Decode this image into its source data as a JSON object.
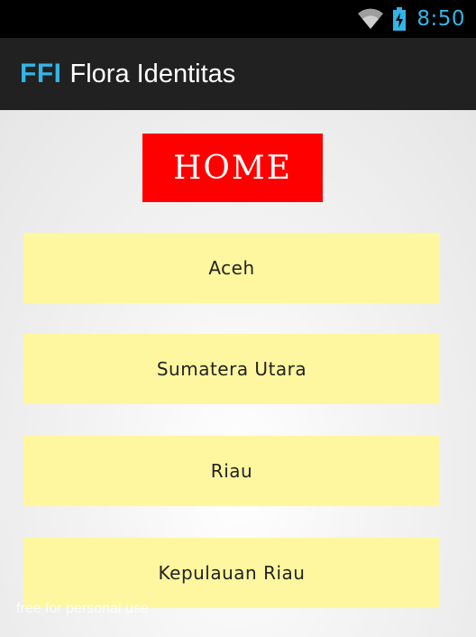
{
  "status_bar": {
    "time": "8:50",
    "wifi_icon": "wifi-icon",
    "battery_icon": "battery-charging-icon",
    "accent_color": "#33b5e5"
  },
  "action_bar": {
    "logo": "FFI",
    "title": "Flora Identitas",
    "background": "#212121"
  },
  "home_banner": {
    "label": "HOME",
    "color": "#fe0000"
  },
  "province_buttons": {
    "color": "#fff79f",
    "items": [
      {
        "label": "Aceh"
      },
      {
        "label": "Sumatera Utara"
      },
      {
        "label": "Riau"
      },
      {
        "label": "Kepulauan Riau"
      }
    ]
  },
  "watermark": "free for personal use"
}
